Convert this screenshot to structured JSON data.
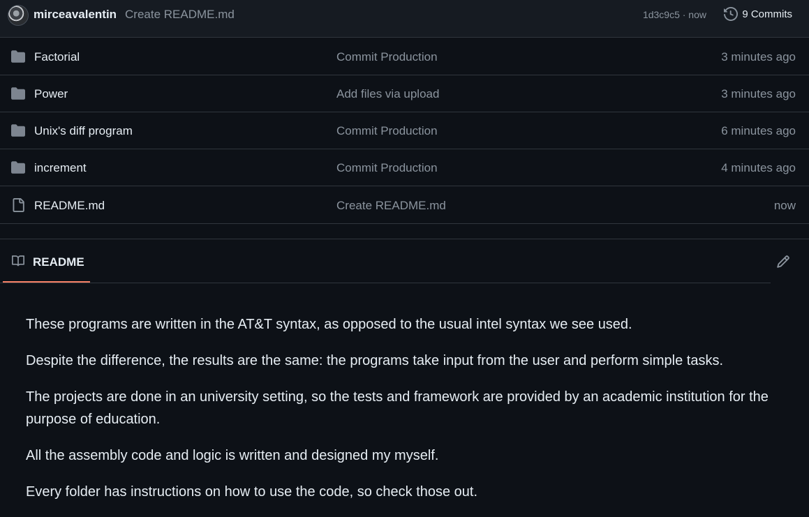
{
  "commit_bar": {
    "author": "mirceavalentin",
    "message": "Create README.md",
    "sha_time": "1d3c9c5 · now",
    "commits_label": "9 Commits",
    "commits_icon": "history-icon"
  },
  "files": [
    {
      "type": "folder",
      "icon": "folder-icon",
      "name": "Factorial",
      "message": "Commit Production",
      "age": "3 minutes ago"
    },
    {
      "type": "folder",
      "icon": "folder-icon",
      "name": "Power",
      "message": "Add files via upload",
      "age": "3 minutes ago"
    },
    {
      "type": "folder",
      "icon": "folder-icon",
      "name": "Unix's diff program",
      "message": "Commit Production",
      "age": "6 minutes ago"
    },
    {
      "type": "folder",
      "icon": "folder-icon",
      "name": "increment",
      "message": "Commit Production",
      "age": "4 minutes ago"
    },
    {
      "type": "file",
      "icon": "file-icon",
      "name": "README.md",
      "message": "Create README.md",
      "age": "now"
    }
  ],
  "readme": {
    "tab_label": "README",
    "tab_icon": "book-icon",
    "edit_icon": "pencil-icon",
    "paragraphs": [
      "These programs are written in the AT&T syntax, as opposed to the usual intel syntax we see used.",
      "Despite the difference, the results are the same: the programs take input from the user and perform simple tasks.",
      "The projects are done in an university setting, so the tests and framework are provided by an academic institution for the purpose of education.",
      "All the assembly code and logic is written and designed my myself.",
      "Every folder has instructions on how to use the code, so check those out."
    ]
  },
  "colors": {
    "background": "#0d1117",
    "header_bg": "#161b22",
    "border": "#30363d",
    "muted_text": "#8b949e",
    "text": "#e6edf3",
    "folder_icon": "#7d8590",
    "tab_underline": "#f78166"
  }
}
